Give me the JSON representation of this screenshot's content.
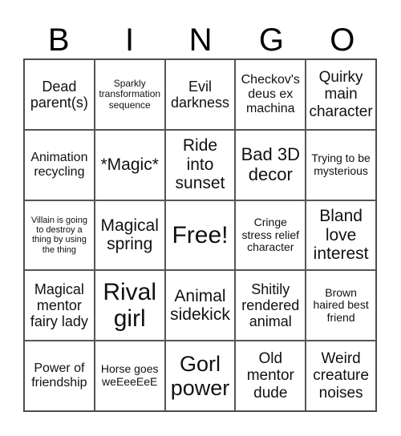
{
  "header": [
    "B",
    "I",
    "N",
    "G",
    "O"
  ],
  "cells": [
    "Dead parent(s)",
    "Sparkly transformation sequence",
    "Evil darkness",
    "Checkov's deus ex machina",
    "Quirky main character",
    "Animation recycling",
    "*Magic*",
    "Ride into sunset",
    "Bad 3D decor",
    "Trying to be mysterious",
    "Villain is going to destroy a thing by using the thing",
    "Magical spring",
    "Free!",
    "Cringe stress relief character",
    "Bland love interest",
    "Magical mentor fairy lady",
    "Rival girl",
    "Animal sidekick",
    "Shitily rendered animal",
    "Brown haired best friend",
    "Power of friendship",
    "Horse goes weEeeEeE",
    "Gorl power",
    "Old mentor dude",
    "Weird creature noises"
  ]
}
